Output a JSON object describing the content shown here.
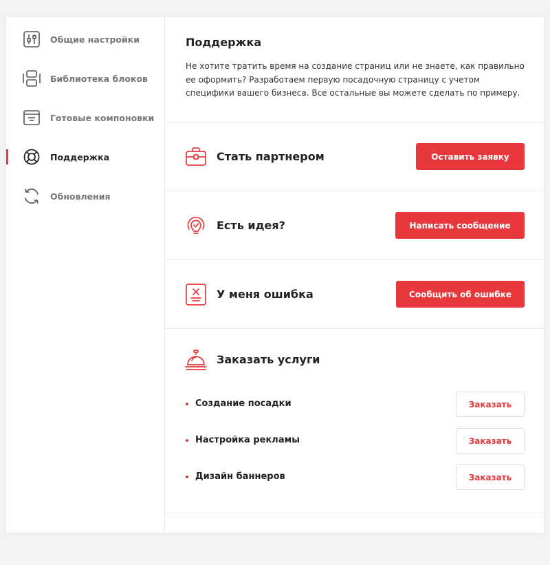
{
  "sidebar": {
    "items": [
      {
        "label": "Общие настройки",
        "icon": "sliders-icon",
        "active": false
      },
      {
        "label": "Библиотека блоков",
        "icon": "blocks-icon",
        "active": false
      },
      {
        "label": "Готовые компоновки",
        "icon": "layout-icon",
        "active": false
      },
      {
        "label": "Поддержка",
        "icon": "lifebuoy-icon",
        "active": true
      },
      {
        "label": "Обновления",
        "icon": "refresh-icon",
        "active": false
      }
    ]
  },
  "intro": {
    "title": "Поддержка",
    "text": "Не хотите тратить время на создание страниц или не знаете, как правильно ее оформить? Разработаем первую посадочную страницу с учетом специфики вашего бизнеса. Все остальные вы можете сделать по примеру."
  },
  "rows": [
    {
      "title": "Стать партнером",
      "button": "Оставить заявку",
      "icon": "briefcase-icon"
    },
    {
      "title": "Есть идея?",
      "button": "Написать сообщение",
      "icon": "lightbulb-icon"
    },
    {
      "title": "У меня ошибка",
      "button": "Сообщить об ошибке",
      "icon": "error-document-icon"
    }
  ],
  "services": {
    "title": "Заказать услуги",
    "icon": "service-bell-icon",
    "items": [
      {
        "label": "Создание посадки",
        "button": "Заказать"
      },
      {
        "label": "Настройка рекламы",
        "button": "Заказать"
      },
      {
        "label": "Дизайн баннеров",
        "button": "Заказать"
      }
    ]
  },
  "colors": {
    "accent": "#e8383d",
    "icon_gray": "#666666",
    "background": "#f2f3f5"
  }
}
